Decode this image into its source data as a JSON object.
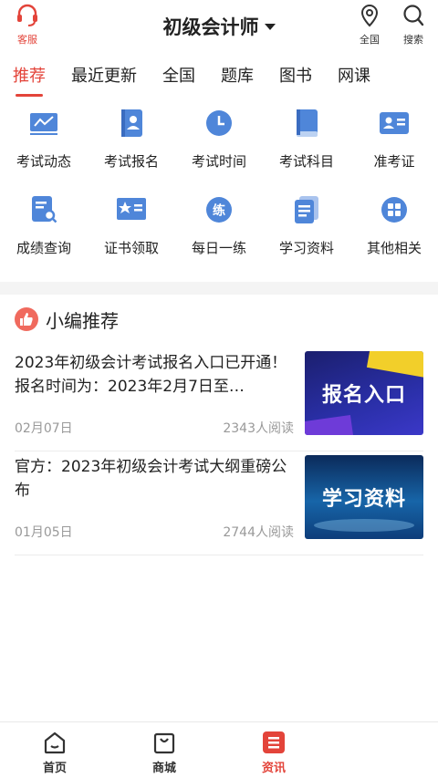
{
  "header": {
    "service_label": "客服",
    "title": "初级会计师",
    "region_label": "全国",
    "search_label": "搜索"
  },
  "tabs": [
    {
      "label": "推荐",
      "active": true
    },
    {
      "label": "最近更新"
    },
    {
      "label": "全国"
    },
    {
      "label": "题库"
    },
    {
      "label": "图书"
    },
    {
      "label": "网课"
    }
  ],
  "grid": [
    {
      "label": "考试动态",
      "icon": "chart-doc-icon"
    },
    {
      "label": "考试报名",
      "icon": "id-book-icon"
    },
    {
      "label": "考试时间",
      "icon": "clock-icon"
    },
    {
      "label": "考试科目",
      "icon": "book-icon"
    },
    {
      "label": "准考证",
      "icon": "id-card-icon"
    },
    {
      "label": "成绩查询",
      "icon": "doc-search-icon"
    },
    {
      "label": "证书领取",
      "icon": "certificate-icon"
    },
    {
      "label": "每日一练",
      "icon": "practice-icon"
    },
    {
      "label": "学习资料",
      "icon": "docs-icon"
    },
    {
      "label": "其他相关",
      "icon": "apps-icon"
    }
  ],
  "section": {
    "title": "小编推荐"
  },
  "news": [
    {
      "title": "2023年初级会计考试报名入口已开通！报名时间为：2023年2月7日至…",
      "date": "02月07日",
      "reads": "2343人阅读",
      "thumb_text": "报名入口"
    },
    {
      "title": "官方：2023年初级会计考试大纲重磅公布",
      "date": "01月05日",
      "reads": "2744人阅读",
      "thumb_text": "学习资料"
    }
  ],
  "bottom_nav": [
    {
      "label": "首页"
    },
    {
      "label": "商城"
    },
    {
      "label": "资讯",
      "active": true
    }
  ],
  "colors": {
    "accent": "#e3443a",
    "icon_blue": "#4f86d9"
  }
}
